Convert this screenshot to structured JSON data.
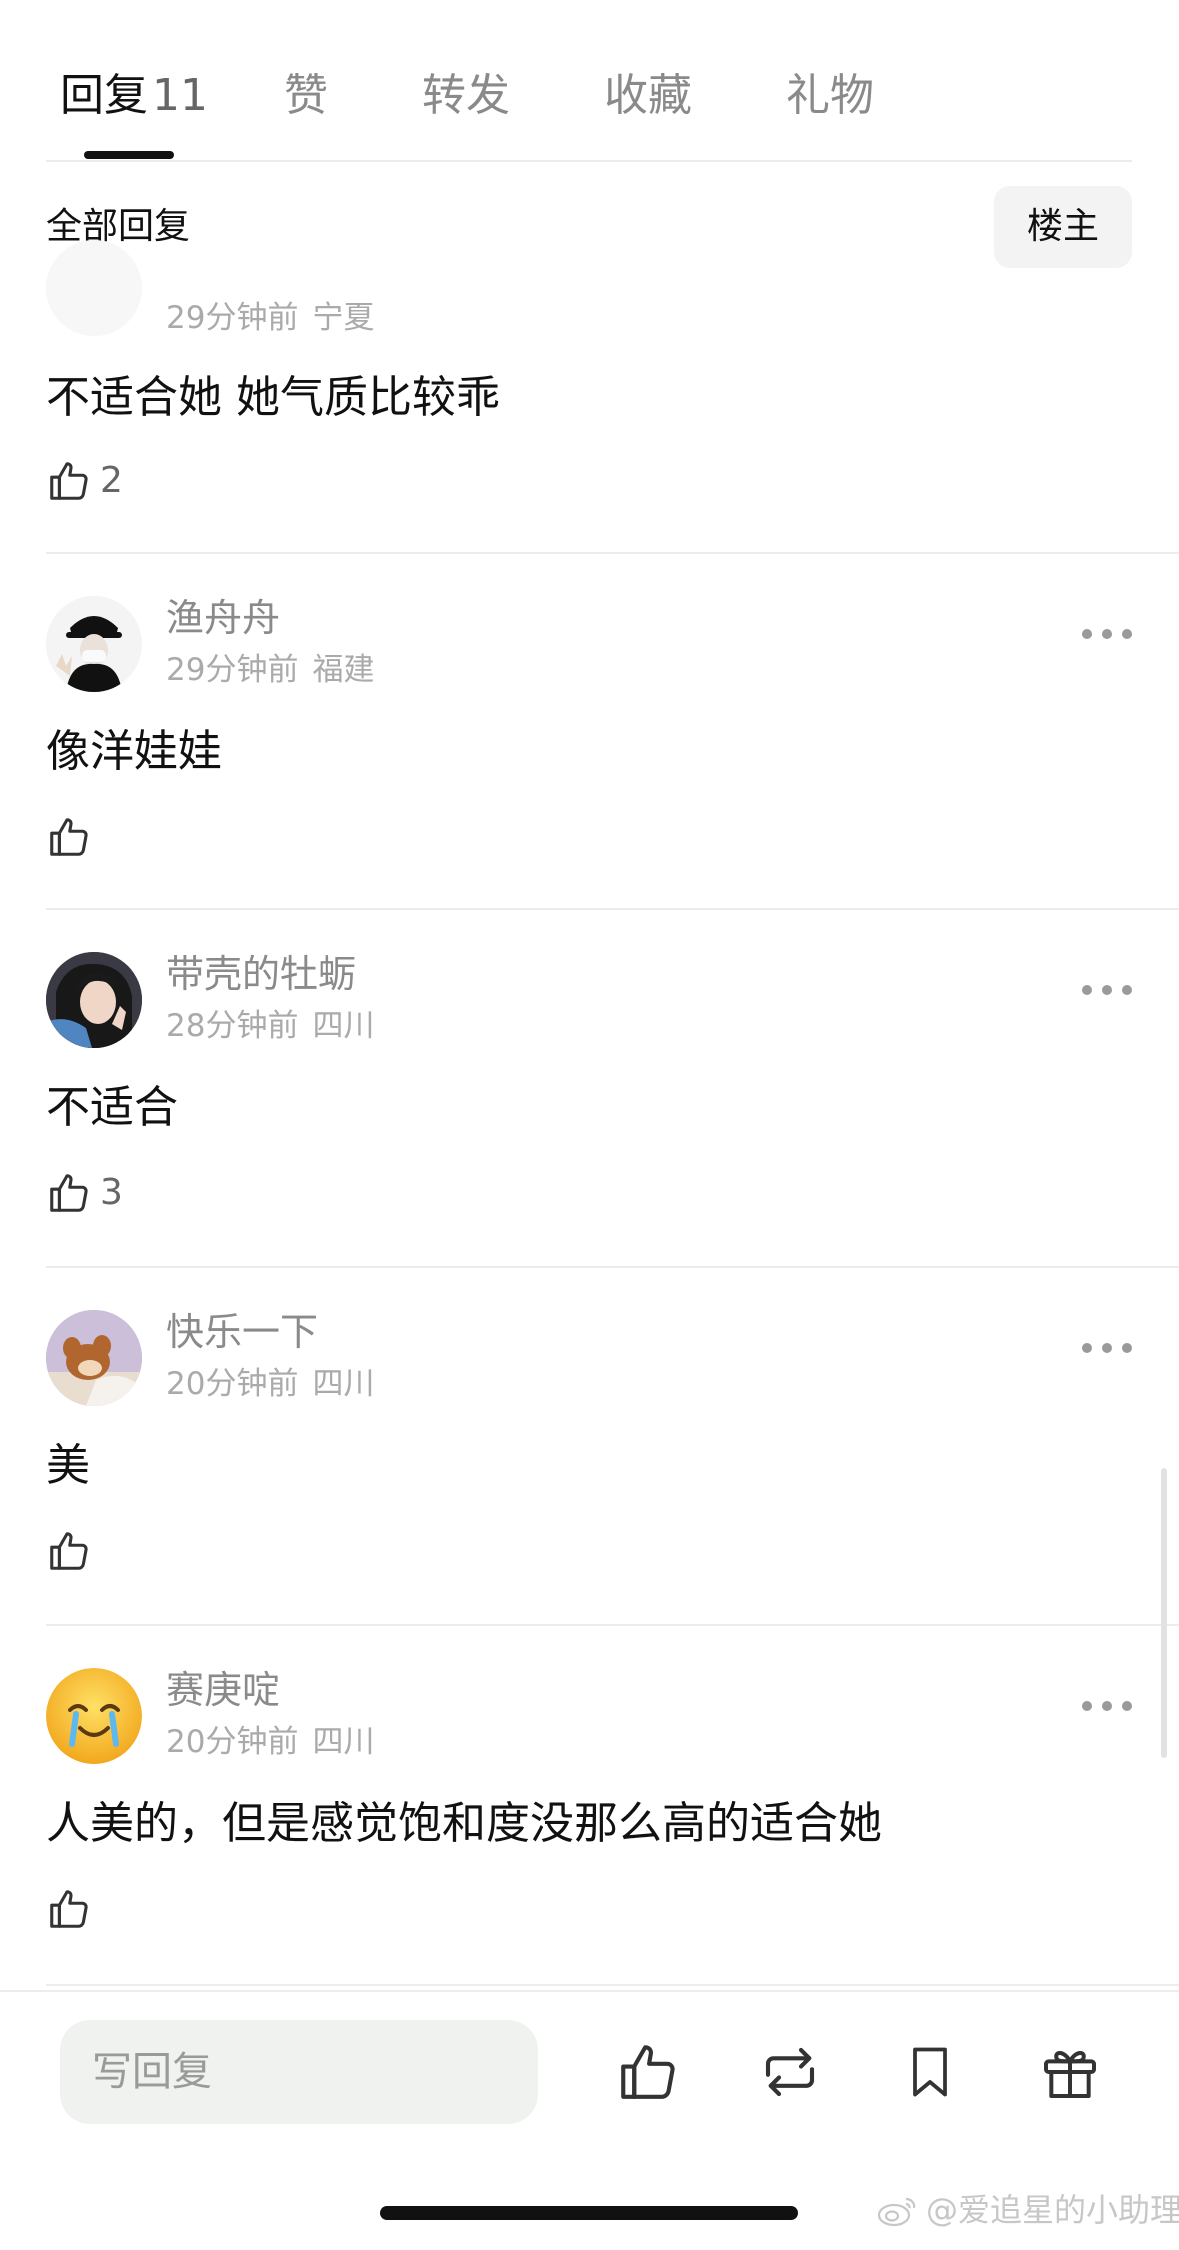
{
  "tabs": [
    {
      "label": "回复",
      "count": "11",
      "active": true
    },
    {
      "label": "赞"
    },
    {
      "label": "转发"
    },
    {
      "label": "收藏"
    },
    {
      "label": "礼物"
    }
  ],
  "section": {
    "title": "全部回复",
    "op_button": "楼主"
  },
  "comments": [
    {
      "name": "",
      "time": "29分钟前",
      "location": "宁夏",
      "text": "不适合她 她气质比较乖",
      "likes": "2"
    },
    {
      "name": "渔舟舟",
      "time": "29分钟前",
      "location": "福建",
      "text": "像洋娃娃",
      "likes": ""
    },
    {
      "name": "带壳的牡蛎",
      "time": "28分钟前",
      "location": "四川",
      "text": "不适合",
      "likes": "3"
    },
    {
      "name": "快乐一下",
      "time": "20分钟前",
      "location": "四川",
      "text": "美",
      "likes": ""
    },
    {
      "name": "赛庚啶",
      "time": "20分钟前",
      "location": "四川",
      "text": "人美的，但是感觉饱和度没那么高的适合她",
      "likes": ""
    }
  ],
  "bottom_bar": {
    "reply_placeholder": "写回复"
  },
  "watermark": "@爱追星的小助理",
  "icons": [
    "thumbs-up-icon",
    "more-icon",
    "repost-icon",
    "bookmark-icon",
    "gift-icon",
    "weibo-logo"
  ]
}
